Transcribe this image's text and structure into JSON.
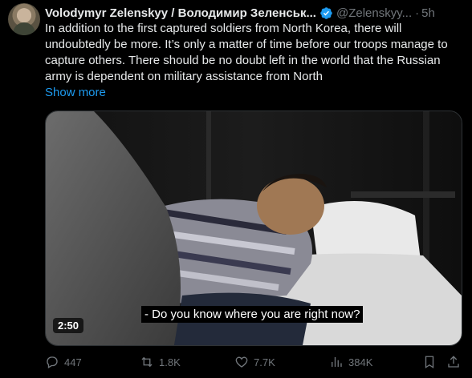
{
  "author": {
    "display_name": "Volodymyr Zelenskyy / Володимир Зеленськ...",
    "handle": "@Zelenskyy...",
    "separator": "·",
    "time": "5h",
    "avatar_icon": "avatar-photo",
    "verified_icon": "verified-badge-icon"
  },
  "tweet": {
    "text": "In addition to the first captured soldiers from North Korea, there will undoubtedly be more. It’s only a matter of time before our troops manage to capture others. There should be no doubt left in the world that the Russian army is dependent on military assistance from North",
    "show_more": "Show more"
  },
  "video": {
    "subtitle": "- Do you know where you are right now?",
    "duration": "2:50"
  },
  "actions": {
    "replies": "447",
    "reposts": "1.8K",
    "likes": "7.7K",
    "views": "384K"
  },
  "colors": {
    "background": "#000000",
    "text": "#e7e9ea",
    "muted": "#71767b",
    "link": "#1d9bf0",
    "verified": "#1d9bf0"
  }
}
